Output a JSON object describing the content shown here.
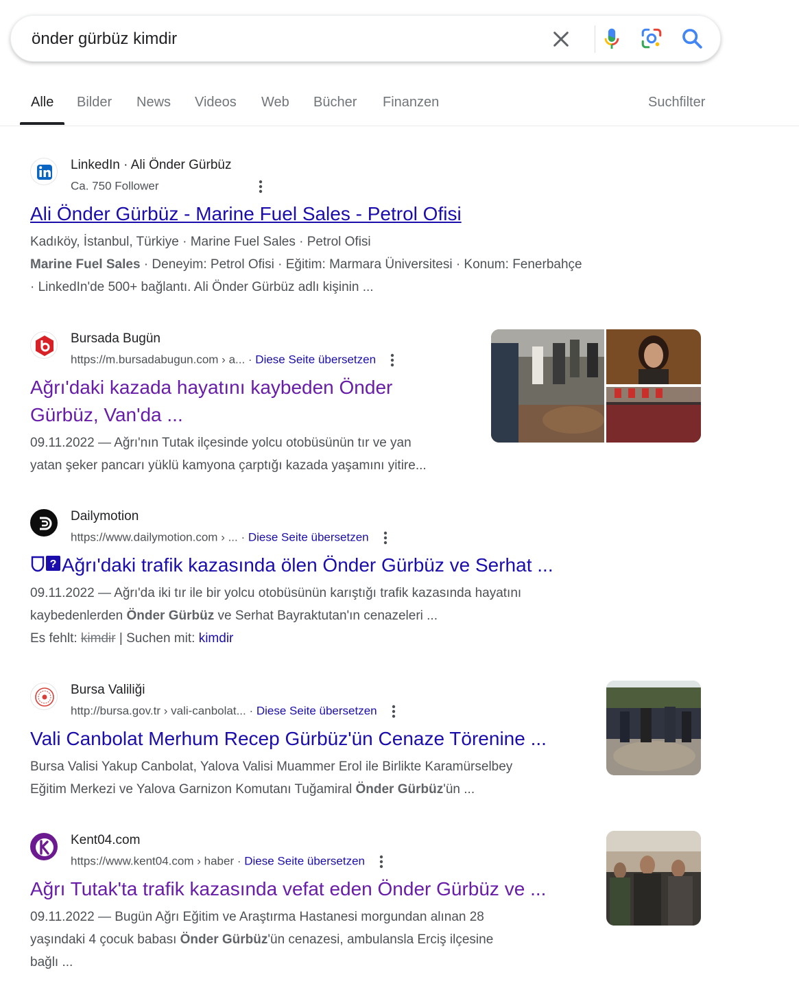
{
  "search": {
    "query": "önder gürbüz kimdir"
  },
  "tabs": [
    "Alle",
    "Bilder",
    "News",
    "Videos",
    "Web",
    "Bücher",
    "Finanzen"
  ],
  "tools_label": "Suchfilter",
  "translate_label": "Diese Seite übersetzen",
  "results": [
    {
      "site": "LinkedIn · Ali Önder Gürbüz",
      "url": "Ca. 750 Follower",
      "title": "Ali Önder Gürbüz - Marine Fuel Sales - Petrol Ofisi",
      "meta_line": "Kadıköy, İstanbul, Türkiye · Marine Fuel Sales · Petrol Ofisi",
      "snippet_bold": "Marine Fuel Sales",
      "snippet_rest": " · Deneyim: Petrol Ofisi · Eğitim: Marmara Üniversitesi · Konum: Fenerbahçe",
      "snippet_line2": "· LinkedIn'de 500+ bağlantı. Ali Önder Gürbüz adlı kişinin ..."
    },
    {
      "site": "Bursada Bugün",
      "url": "https://m.bursadabugun.com › a...",
      "title_line1": "Ağrı'daki kazada hayatını kaybeden Önder",
      "title_line2": "Gürbüz, Van'da ...",
      "snippet_line1": "09.11.2022 — Ağrı'nın Tutak ilçesinde yolcu otobüsünün tır ve yan",
      "snippet_line2": "yatan şeker pancarı yüklü kamyona çarptığı kazada yaşamını yitire..."
    },
    {
      "site": "Dailymotion",
      "url": "https://www.dailymotion.com › ...",
      "title": "Ağrı'daki trafik kazasında ölen Önder Gürbüz ve Serhat ...",
      "snippet_line1": "09.11.2022 — Ağrı'da iki tır ile bir yolcu otobüsünün karıştığı trafik kazasında hayatını",
      "snippet_line2_pre": "kaybedenlerden ",
      "snippet_line2_bold": "Önder Gürbüz",
      "snippet_line2_post": " ve Serhat Bayraktutan'ın cenazeleri ...",
      "missing_label": "Es fehlt: ",
      "missing_term": "kimdir",
      "search_with_label": " | Suchen mit: ",
      "search_with_term": "kimdir"
    },
    {
      "site": "Bursa Valiliği",
      "url": "http://bursa.gov.tr › vali-canbolat...",
      "title": "Vali Canbolat Merhum Recep Gürbüz'ün Cenaze Törenine ...",
      "snippet_line1": "Bursa Valisi Yakup Canbolat, Yalova Valisi Muammer Erol ile Birlikte Karamürselbey",
      "snippet_line2_pre": "Eğitim Merkezi ve Yalova Garnizon Komutanı Tuğamiral ",
      "snippet_line2_bold": "Önder Gürbüz",
      "snippet_line2_post": "'ün ..."
    },
    {
      "site": "Kent04.com",
      "url": "https://www.kent04.com › haber",
      "title": "Ağrı Tutak'ta trafik kazasında vefat eden Önder Gürbüz ve ...",
      "snippet_line1": "09.11.2022 — Bugün Ağrı Eğitim ve Araştırma Hastanesi morgundan alınan 28",
      "snippet_line2_pre": "yaşındaki 4 çocuk babası ",
      "snippet_line2_bold": "Önder Gürbüz",
      "snippet_line2_post": "'ün cenazesi, ambulansla Erciş ilçesine",
      "snippet_line3": "bağlı ..."
    }
  ]
}
